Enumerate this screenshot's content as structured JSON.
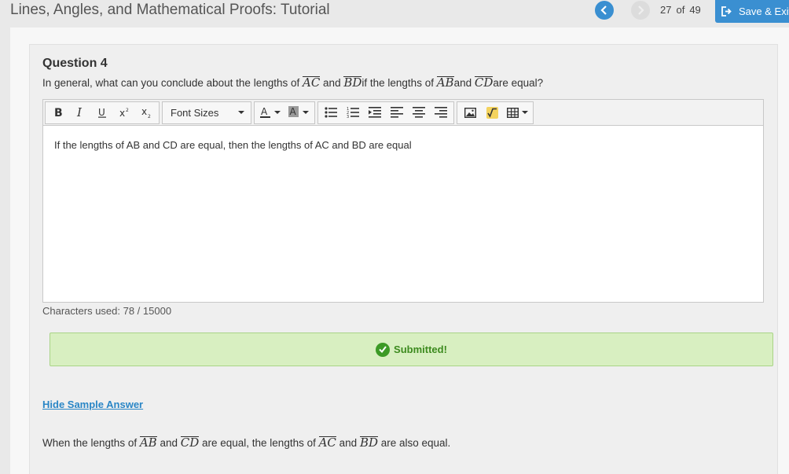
{
  "header": {
    "course_title": "Lines, Angles, and Mathematical Proofs: Tutorial",
    "page_current": "27",
    "page_of": "of",
    "page_total": "49",
    "save_exit_label": "Save & Exit"
  },
  "question": {
    "title": "Question 4",
    "text_1": "In general, what can you conclude about the lengths of ",
    "seg_1": "AC",
    "text_2": " and ",
    "seg_2": "BD",
    "text_3": "if the lengths of ",
    "seg_3": "AB",
    "text_4": "and ",
    "seg_4": "CD",
    "text_5": "are equal?"
  },
  "editor": {
    "font_sizes_label": "Font Sizes",
    "answer_text": "If the lengths of AB and CD are equal, then the lengths of AC and BD are equal",
    "char_count": "Characters used: 78 / 15000"
  },
  "status": {
    "submitted_label": "Submitted!",
    "color": "#3c8a1e"
  },
  "sample": {
    "hide_label": "Hide Sample Answer",
    "text_1": "When the lengths of ",
    "seg_1": "AB",
    "text_2": " and ",
    "seg_2": "CD",
    "text_3": " are equal, the lengths of ",
    "seg_3": "AC",
    "text_4": " and ",
    "seg_4": "BD",
    "text_5": " are also equal."
  },
  "colors": {
    "accent": "#3a8fd1",
    "success_bg": "#d8efc1"
  }
}
